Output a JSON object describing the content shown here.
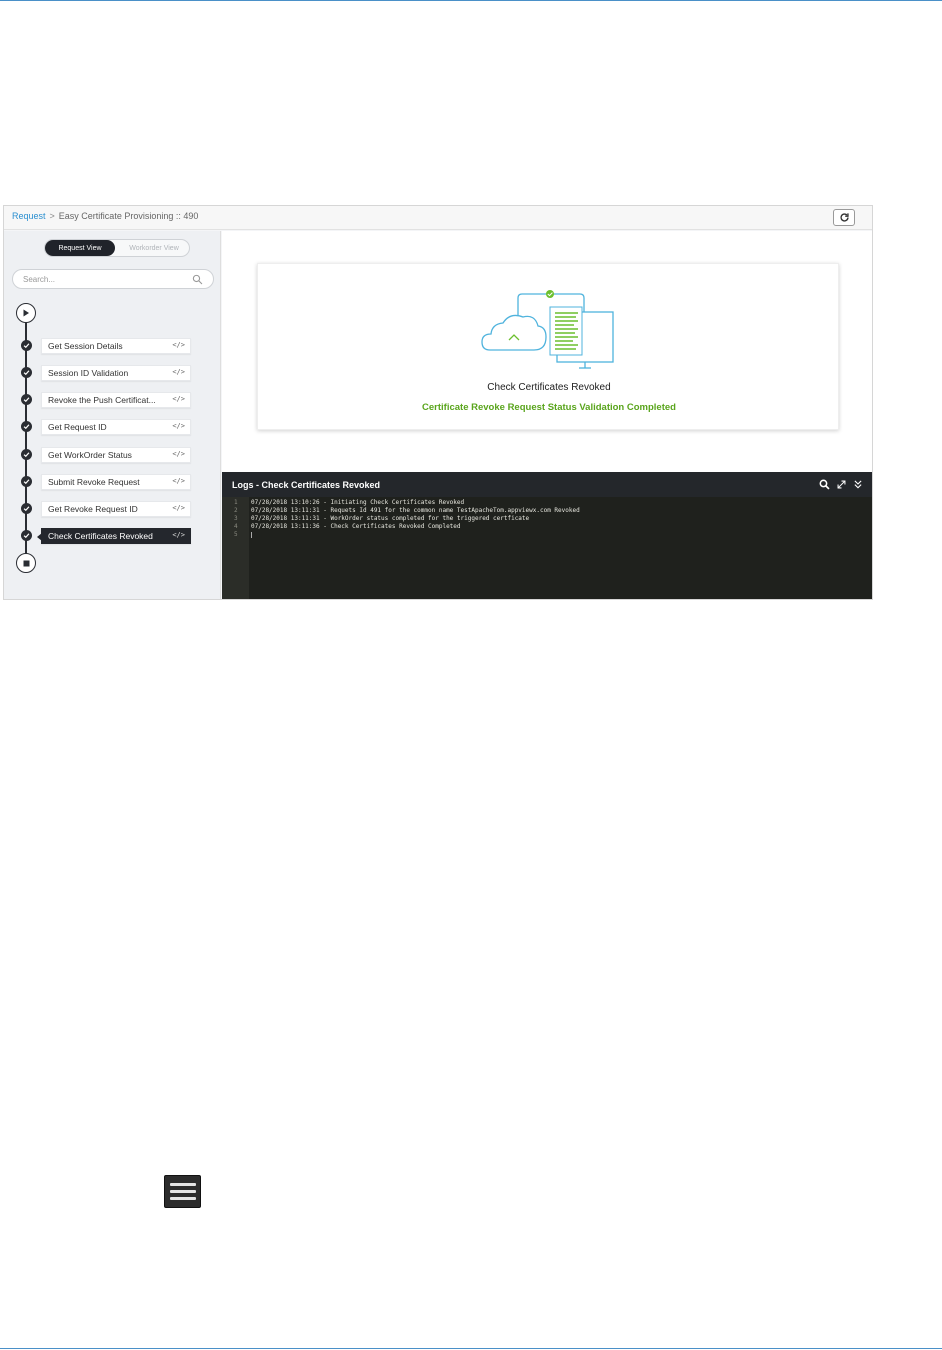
{
  "header": {
    "breadcrumb_root": "Request",
    "breadcrumb_separator": ">",
    "breadcrumb_current": "Easy Certificate Provisioning :: 490"
  },
  "sidebar": {
    "view_toggle": {
      "active": "Request View",
      "inactive": "Workorder View"
    },
    "search": {
      "placeholder": "Search..."
    },
    "steps": [
      {
        "label": "Get Session Details",
        "code": "</>"
      },
      {
        "label": "Session ID Validation",
        "code": "</>"
      },
      {
        "label": "Revoke the Push Certificat...",
        "code": "</>"
      },
      {
        "label": "Get Request ID",
        "code": "</>"
      },
      {
        "label": "Get WorkOrder Status",
        "code": "</>"
      },
      {
        "label": "Submit Revoke Request",
        "code": "</>"
      },
      {
        "label": "Get Revoke Request ID",
        "code": "</>"
      },
      {
        "label": "Check Certificates Revoked",
        "code": "</>",
        "active": true
      }
    ]
  },
  "status": {
    "title": "Check Certificates Revoked",
    "subtitle": "Certificate Revoke Request Status Validation Completed"
  },
  "logs": {
    "title": "Logs - Check Certificates Revoked",
    "lines": [
      {
        "num": "1",
        "text": "07/28/2018 13:10:26  - Initiating Check Certificates Revoked"
      },
      {
        "num": "2",
        "text": "07/28/2018 13:11:31  - Requets Id 491 for the common name TestApacheTom.appviewx.com Revoked"
      },
      {
        "num": "3",
        "text": "07/28/2018 13:11:31  - WorkOrder status completed for the triggered certficate"
      },
      {
        "num": "4",
        "text": "07/28/2018 13:11:36  - Check Certificates Revoked Completed"
      },
      {
        "num": "5",
        "text": ""
      }
    ]
  },
  "colors": {
    "accent": "#2a8fd0",
    "success": "#5aa51d",
    "dark": "#24272d",
    "log_bg": "#1f211d"
  },
  "icons": {
    "refresh": "refresh-icon",
    "search": "search-icon",
    "log_search": "search-icon",
    "expand": "expand-icon",
    "collapse": "double-chevron-down-icon",
    "menu": "hamburger-menu-icon"
  }
}
